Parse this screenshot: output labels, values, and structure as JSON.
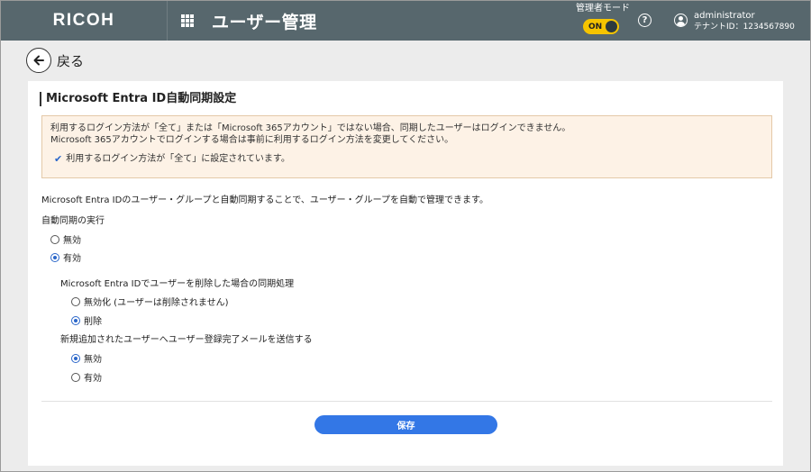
{
  "header": {
    "logo": "RICOH",
    "app_title": "ユーザー管理",
    "admin_mode_label": "管理者モード",
    "admin_toggle": "ON",
    "help_glyph": "?",
    "user_name": "administrator",
    "tenant": "テナントID：1234567890",
    "colors": {
      "background": "#57676d",
      "toggle": "#f5c400"
    }
  },
  "back": {
    "label": "戻る",
    "icon": "arrow-left-icon"
  },
  "section": {
    "title": "Microsoft Entra ID自動同期設定",
    "warning_line1": "利用するログイン方法が「全て」または「Microsoft 365アカウント」ではない場合、同期したユーザーはログインできません。",
    "warning_line2": "Microsoft 365アカウントでログインする場合は事前に利用するログイン方法を変更してください。",
    "warning_check": "利用するログイン方法が「全て」に設定されています。",
    "description": "Microsoft Entra IDのユーザー・グループと自動同期することで、ユーザー・グループを自動で管理できます。"
  },
  "auto_sync": {
    "label": "自動同期の実行",
    "options": [
      {
        "label": "無効",
        "checked": false
      },
      {
        "label": "有効",
        "checked": true
      }
    ]
  },
  "delete_sync": {
    "label": "Microsoft Entra IDでユーザーを削除した場合の同期処理",
    "options": [
      {
        "label": "無効化 (ユーザーは削除されません)",
        "checked": false
      },
      {
        "label": "削除",
        "checked": true
      }
    ]
  },
  "mail": {
    "label": "新規追加されたユーザーへユーザー登録完了メールを送信する",
    "options": [
      {
        "label": "無効",
        "checked": true
      },
      {
        "label": "有効",
        "checked": false
      }
    ]
  },
  "save_label": "保存",
  "accent_color": "#3377e6"
}
